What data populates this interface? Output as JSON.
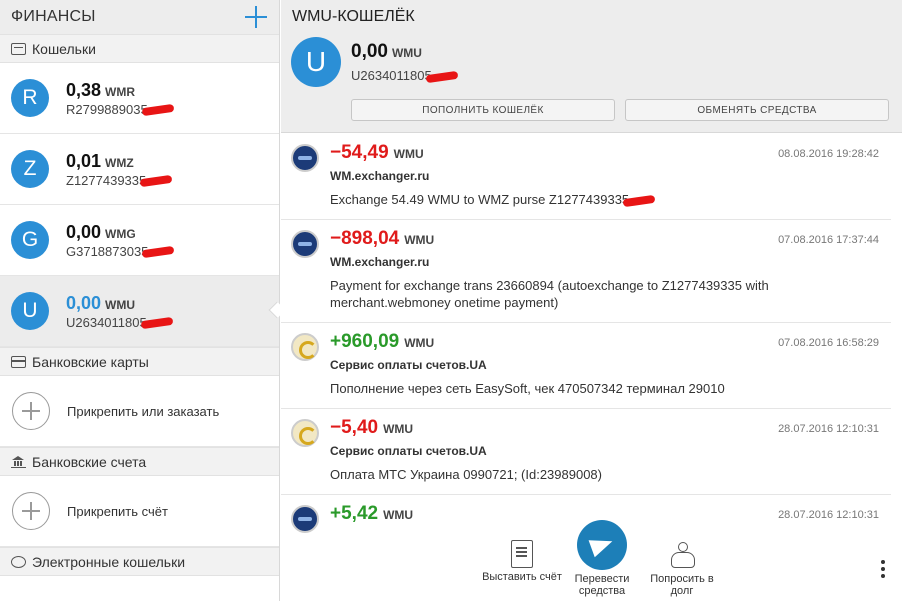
{
  "left": {
    "title": "ФИНАНСЫ",
    "sections": {
      "wallets": "Кошельки",
      "cards": "Банковские карты",
      "accounts": "Банковские счета",
      "ewallets": "Электронные кошельки"
    },
    "wallets": [
      {
        "letter": "R",
        "amount": "0,38",
        "currency": "WMR",
        "id": "R2799889035"
      },
      {
        "letter": "Z",
        "amount": "0,01",
        "currency": "WMZ",
        "id": "Z1277439335"
      },
      {
        "letter": "G",
        "amount": "0,00",
        "currency": "WMG",
        "id": "G3718873035"
      },
      {
        "letter": "U",
        "amount": "0,00",
        "currency": "WMU",
        "id": "U2634011805"
      }
    ],
    "attach_card": "Прикрепить или заказать",
    "attach_account": "Прикрепить счёт"
  },
  "header": {
    "title": "WMU-КОШЕЛЁК",
    "letter": "U",
    "amount": "0,00",
    "currency": "WMU",
    "id": "U2634011805",
    "topup_label": "ПОПОЛНИТЬ КОШЕЛЁК",
    "exchange_label": "ОБМЕНЯТЬ СРЕДСТВА"
  },
  "transactions": [
    {
      "amount": "−54,49",
      "currency": "WMU",
      "date": "08.08.2016 19:28:42",
      "from": "WM.exchanger.ru",
      "desc": "Exchange 54.49 WMU to WMZ purse Z1277439335"
    },
    {
      "amount": "−898,04",
      "currency": "WMU",
      "date": "07.08.2016 17:37:44",
      "from": "WM.exchanger.ru",
      "desc": "Payment for exchange trans 23660894 (autoexchange to Z1277439335 with merchant.webmoney onetime payment)"
    },
    {
      "amount": "+960,09",
      "currency": "WMU",
      "date": "07.08.2016 16:58:29",
      "from": "Сервис оплаты счетов.UA",
      "desc": "Пополнение через сеть EasySoft, чек 470507342 терминал 29010"
    },
    {
      "amount": "−5,40",
      "currency": "WMU",
      "date": "28.07.2016 12:10:31",
      "from": "Сервис оплаты счетов.UA",
      "desc": "Оплата МТС Украина 0990721; (Id:23989008)"
    },
    {
      "amount": "+5,42",
      "currency": "WMU",
      "date": "28.07.2016 12:10:31",
      "from": "",
      "desc": ""
    }
  ],
  "bottom": {
    "invoice": "Выставить счёт",
    "transfer": "Перевести средства",
    "request": "Попросить в долг"
  },
  "colors": {
    "accent": "#2b8fd6",
    "negative": "#e01b1b",
    "positive": "#2a9a2a"
  }
}
